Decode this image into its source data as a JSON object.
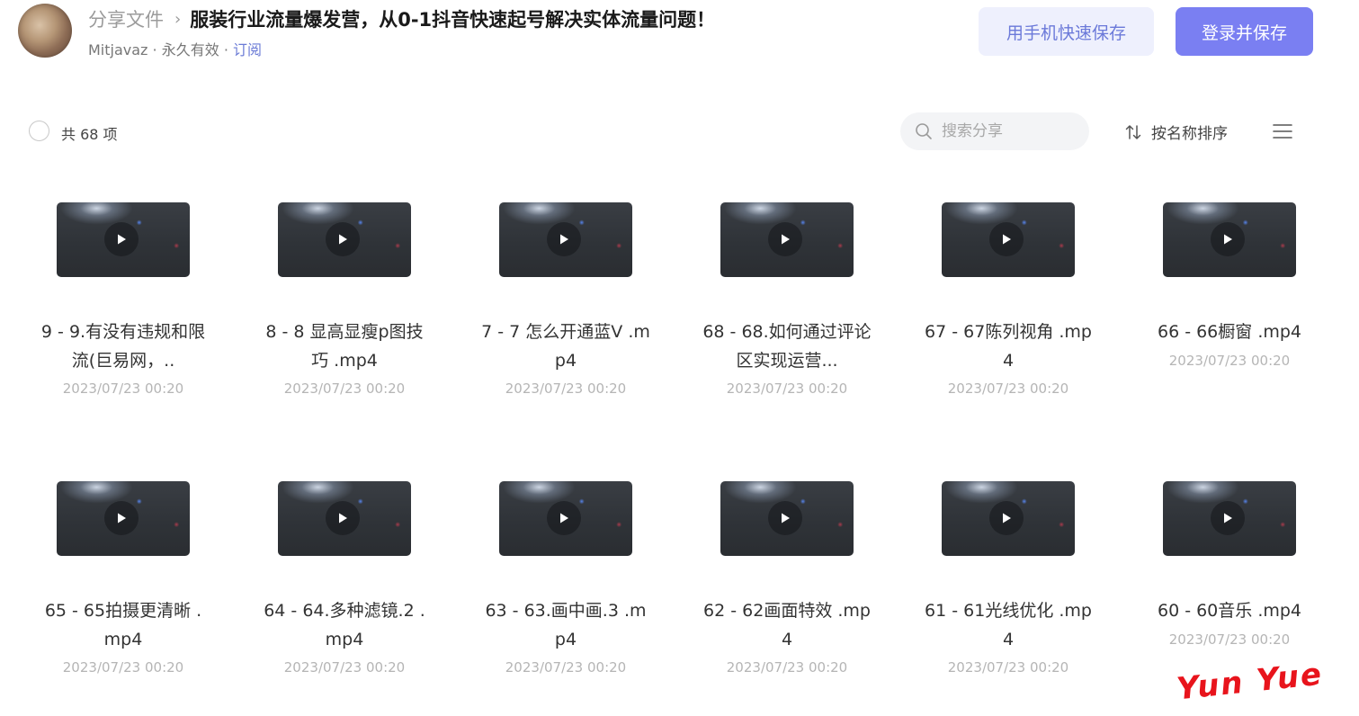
{
  "header": {
    "breadcrumb_root": "分享文件",
    "breadcrumb_sep": "›",
    "title": "服装行业流量爆发营，从0-1抖音快速起号解决实体流量问题！",
    "owner": "Mitjavaz",
    "validity": "永久有效",
    "meta_sep": " · ",
    "subscribe": "订阅",
    "phone_save_label": "用手机快速保存",
    "login_save_label": "登录并保存"
  },
  "toolbar": {
    "count_label": "共 68 项",
    "search_placeholder": "搜索分享",
    "sort_label": "按名称排序"
  },
  "files": [
    {
      "name": "9 - 9.有没有违规和限流(巨易网，..",
      "date": "2023/07/23 00:20"
    },
    {
      "name": "8 - 8 显高显瘦p图技巧 .mp4",
      "date": "2023/07/23 00:20"
    },
    {
      "name": "7 - 7 怎么开通蓝V .mp4",
      "date": "2023/07/23 00:20"
    },
    {
      "name": "68 - 68.如何通过评论区实现运营...",
      "date": "2023/07/23 00:20"
    },
    {
      "name": "67 - 67陈列视角 .mp4",
      "date": "2023/07/23 00:20"
    },
    {
      "name": "66 - 66橱窗 .mp4",
      "date": "2023/07/23 00:20"
    },
    {
      "name": "65 - 65拍摄更清晰 .mp4",
      "date": "2023/07/23 00:20"
    },
    {
      "name": "64 - 64.多种滤镜.2 .mp4",
      "date": "2023/07/23 00:20"
    },
    {
      "name": "63 - 63.画中画.3 .mp4",
      "date": "2023/07/23 00:20"
    },
    {
      "name": "62 - 62画面特效 .mp4",
      "date": "2023/07/23 00:20"
    },
    {
      "name": "61 - 61光线优化 .mp4",
      "date": "2023/07/23 00:20"
    },
    {
      "name": "60 - 60音乐 .mp4",
      "date": "2023/07/23 00:20"
    }
  ],
  "watermark": "Yun Yue"
}
